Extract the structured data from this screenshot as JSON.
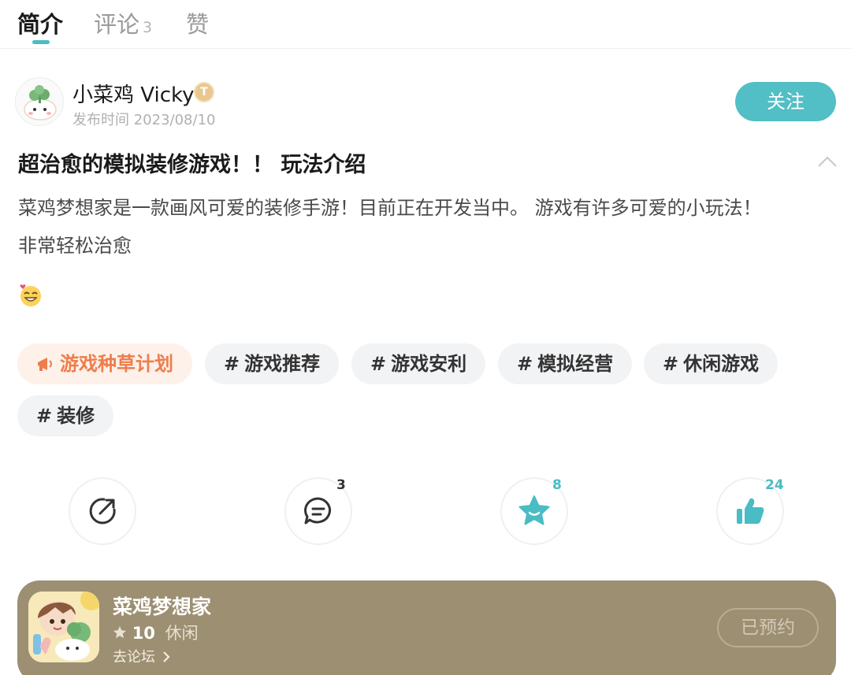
{
  "tabs": [
    {
      "label": "简介",
      "active": true
    },
    {
      "label": "评论",
      "count": "3",
      "active": false
    },
    {
      "label": "赞",
      "active": false
    }
  ],
  "author": {
    "name": "小菜鸡 Vicky",
    "badge": "T",
    "publish_time": "发布时间 2023/08/10",
    "follow_label": "关注"
  },
  "post": {
    "title": "超治愈的模拟装修游戏！！ 玩法介绍",
    "body_line1": "菜鸡梦想家是一款画风可爱的装修手游！目前正在开发当中。 游戏有许多可爱的小玩法！",
    "body_line2": "非常轻松治愈"
  },
  "tags": [
    {
      "label": "游戏种草计划",
      "featured": true,
      "icon": "megaphone-icon"
    },
    {
      "label": "游戏推荐",
      "prefix": "#"
    },
    {
      "label": "游戏安利",
      "prefix": "#"
    },
    {
      "label": "模拟经营",
      "prefix": "#"
    },
    {
      "label": "休闲游戏",
      "prefix": "#"
    },
    {
      "label": "装修",
      "prefix": "#"
    }
  ],
  "actions": {
    "share": {
      "icon": "share-icon"
    },
    "comment": {
      "icon": "comment-icon",
      "count": "3"
    },
    "favorite": {
      "icon": "star-icon",
      "count": "8"
    },
    "like": {
      "icon": "thumbs-up-icon",
      "count": "24"
    }
  },
  "game": {
    "name": "菜鸡梦想家",
    "score": "10",
    "genre": "休闲",
    "forum_label": "去论坛",
    "reserved_label": "已预约"
  },
  "colors": {
    "accent": "#52bec6",
    "tag_featured": "#ee7d4c",
    "card_bg": "#9d8f72"
  }
}
